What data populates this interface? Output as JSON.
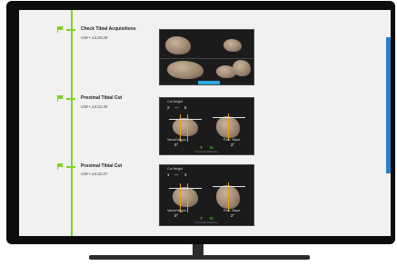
{
  "colors": {
    "timeline_green": "#7ed321",
    "accent_blue": "#2d7fc7",
    "bezel": "#0d0d0f",
    "screen_bg": "#f1f1f1"
  },
  "entries": [
    {
      "title": "Check Tibial Acquisitions",
      "time": "OW • 14:20:28",
      "icon": "flag-icon"
    },
    {
      "title": "Proximal Tibial Cut",
      "time": "OW • 14:31:45",
      "icon": "flag-icon",
      "panel": {
        "cut_height_label": "Cut Height",
        "cut_height_left": "2",
        "cut_height_right": "6",
        "left_label": "Varus/Valgus",
        "left_value": "0°",
        "right_label": "Post. Slope",
        "right_value": "2°",
        "mid_left": "Y",
        "mid_right": "G",
        "footer": "Proximal Tibial Cut"
      }
    },
    {
      "title": "Proximal Tibial Cut",
      "time": "OW • 14:32:27",
      "icon": "flag-icon",
      "panel": {
        "cut_height_label": "Cut Height",
        "cut_height_left": "1",
        "cut_height_right": "3",
        "left_label": "Varus/Valgus",
        "left_value": "0°",
        "right_label": "Post. Slope",
        "right_value": "2°",
        "mid_left": "Y",
        "mid_right": "G",
        "footer": "Proximal Tibial Cut"
      }
    }
  ]
}
